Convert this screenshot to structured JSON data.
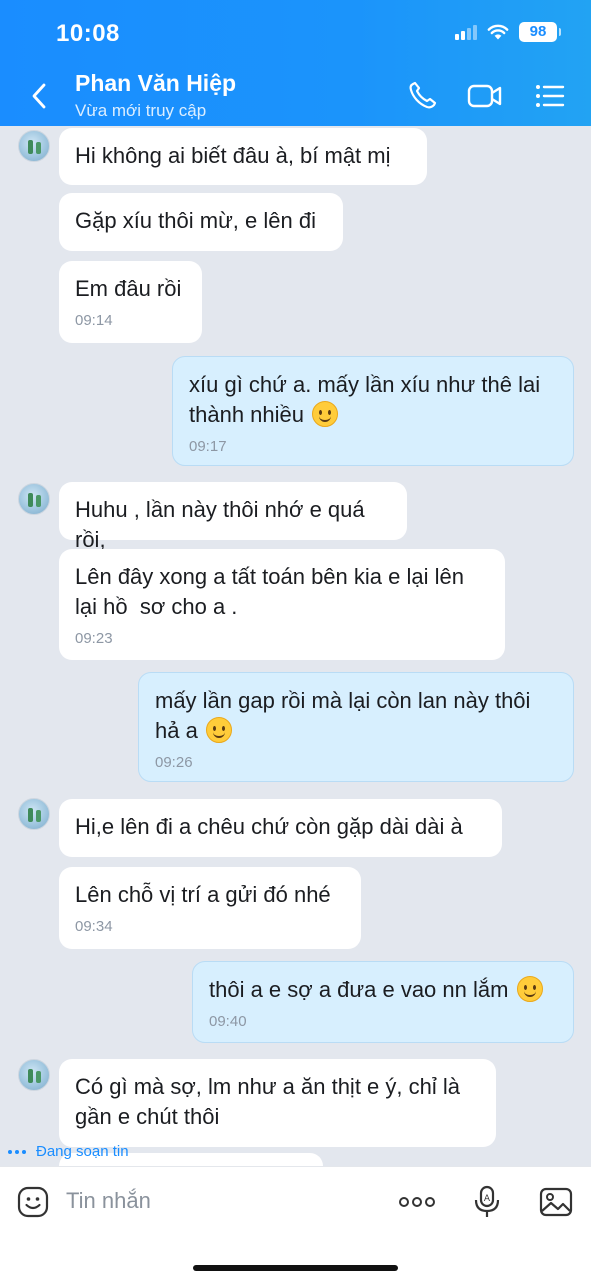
{
  "status_bar": {
    "time": "10:08",
    "battery": "98"
  },
  "header": {
    "contact_name": "Phan Văn Hiệp",
    "contact_status": "Vừa mới truy cập",
    "icons": [
      "back-arrow-icon",
      "phone-icon",
      "video-call-icon",
      "menu-list-icon"
    ]
  },
  "messages": [
    {
      "from": "contact",
      "text": "Hi không ai biết đâu à, bí mật mị"
    },
    {
      "from": "contact",
      "text": "Gặp xíu thôi mừ, e lên đi"
    },
    {
      "from": "contact",
      "text": "Em đâu rồi",
      "time": "09:14"
    },
    {
      "from": "me",
      "line1": "xíu gì chứ a. mấy lần xíu như thê lai",
      "line2": "thành nhiều",
      "emoji": "smiling-face-emoji",
      "time": "09:17"
    },
    {
      "from": "contact",
      "text": "Huhu , lần này thôi nhớ e quá rồi,"
    },
    {
      "from": "contact",
      "line1": "Lên đây xong a tất toán bên kia e lại lên",
      "line2": "lại hồ  sơ cho a .",
      "time": "09:23"
    },
    {
      "from": "me",
      "line1": "mấy lần gap rồi mà lại còn lan này thôi",
      "line2": "hả a",
      "emoji": "smiling-face-emoji",
      "time": "09:26"
    },
    {
      "from": "contact",
      "text": "Hi,e lên đi a chêu chứ còn gặp dài dài à"
    },
    {
      "from": "contact",
      "text": "Lên chỗ vị trí a gửi đó nhé",
      "time": "09:34"
    },
    {
      "from": "me",
      "text": "thôi a e sợ a đưa e vao nn lắm",
      "emoji": "smiling-face-emoji",
      "time": "09:40"
    },
    {
      "from": "contact",
      "line1": "Có gì mà sợ, lm như a ăn thịt e ý, chỉ là",
      "line2": "gần e chút thôi"
    }
  ],
  "typing_indicator": "Đang soạn tin",
  "input_bar": {
    "placeholder": "Tin nhắn",
    "icons": [
      "sticker-icon",
      "more-options-icon",
      "voice-input-icon",
      "image-icon"
    ]
  },
  "colors": {
    "header_blue": "#1a8dff",
    "outgoing_bubble": "#d7effe",
    "incoming_bubble": "#ffffff",
    "chat_background": "#e3e7ee"
  }
}
